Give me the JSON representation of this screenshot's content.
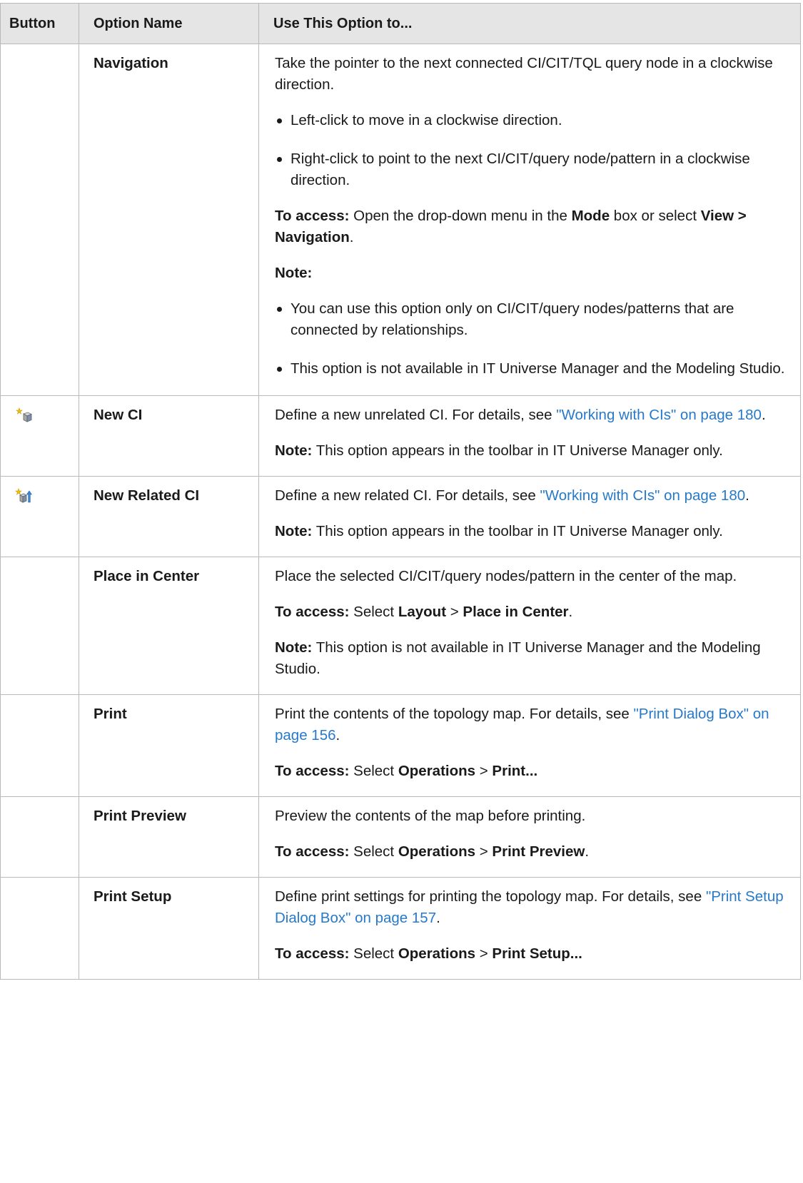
{
  "table": {
    "headers": {
      "button": "Button",
      "option_name": "Option Name",
      "use_to": "Use This Option to..."
    },
    "rows": [
      {
        "name": "Navigation",
        "desc": "Take the pointer to the next connected CI/CIT/TQL query node in a clockwise direction.",
        "bullet1": "Left-click to move in a clockwise direction.",
        "bullet2": "Right-click to point to the next CI/CIT/query node/pattern in a clockwise direction.",
        "access_label": "To access:",
        "access_t1": " Open the drop-down menu in the ",
        "access_b1": "Mode",
        "access_t2": " box or select ",
        "access_b2": "View > Navigation",
        "access_t3": ".",
        "note_label": "Note:",
        "note_bullet1": "You can use this option only on CI/CIT/query nodes/patterns that are connected by relationships.",
        "note_bullet2": "This option is not available in IT Universe Manager and the Modeling Studio."
      },
      {
        "icon": "new-ci-icon",
        "name": "New CI",
        "desc_t1": "Define a new unrelated CI. For details, see ",
        "desc_link": "\"Working with CIs\" on page 180",
        "desc_t2": ".",
        "note_label": "Note:",
        "note_text": " This option appears in the toolbar in IT Universe Manager only."
      },
      {
        "icon": "new-related-ci-icon",
        "name": "New Related CI",
        "desc_t1": "Define a new related CI. For details, see ",
        "desc_link": "\"Working with CIs\" on page 180",
        "desc_t2": ".",
        "note_label": "Note:",
        "note_text": " This option appears in the toolbar in IT Universe Manager only."
      },
      {
        "name": "Place in Center",
        "desc": "Place the selected CI/CIT/query nodes/pattern in the center of the map.",
        "access_label": "To access:",
        "access_t1": " Select ",
        "access_b1": "Layout",
        "access_t2": " > ",
        "access_b2": "Place in Center",
        "access_t3": ".",
        "note_label": "Note:",
        "note_text": " This option is not available in IT Universe Manager and the Modeling Studio."
      },
      {
        "name": "Print",
        "desc_t1": "Print the contents of the topology map. For details, see ",
        "desc_link": "\"Print Dialog Box\" on page 156",
        "desc_t2": ".",
        "access_label": "To access:",
        "access_t1": " Select ",
        "access_b1": "Operations",
        "access_t2": " > ",
        "access_b2": "Print..."
      },
      {
        "name": "Print Preview",
        "desc": "Preview the contents of the map before printing.",
        "access_label": "To access:",
        "access_t1": " Select ",
        "access_b1": "Operations",
        "access_t2": " > ",
        "access_b2": "Print Preview",
        "access_t3": "."
      },
      {
        "name": "Print Setup",
        "desc_t1": "Define print settings for printing the topology map. For details, see ",
        "desc_link": "\"Print Setup Dialog Box\" on page 157",
        "desc_t2": ".",
        "access_label": "To access:",
        "access_t1": " Select ",
        "access_b1": "Operations",
        "access_t2": " > ",
        "access_b2": "Print Setup..."
      }
    ]
  }
}
